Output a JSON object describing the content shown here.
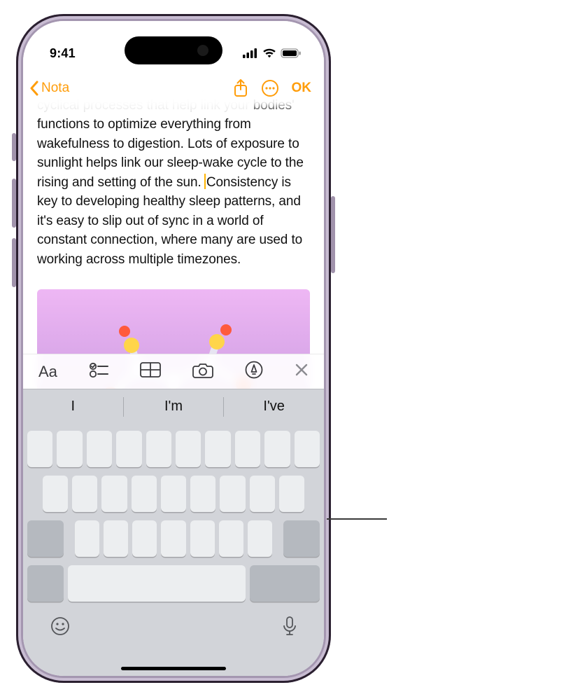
{
  "status": {
    "time": "9:41"
  },
  "nav": {
    "back_label": "Nota",
    "ok_label": "OK"
  },
  "note": {
    "faded_prefix": "sunlight has a positive effect on the sleep/wake cycle, primarily because it is important at our circadian rhythm – a series of cyclical processes that help link your ",
    "body_a": "bodies' functions to optimize everything from wakefulness to digestion. Lots of exposure to sunlight helps link our sleep-wake cycle to the rising and setting of the sun. ",
    "body_b": "Consistency is key to developing healthy sleep patterns, and it's easy to slip out of sync in a world of constant connection, where many are used to working across multiple timezones."
  },
  "suggestions": {
    "s1": "I",
    "s2": "I'm",
    "s3": "I've"
  },
  "toolbar": {
    "format": "Aa"
  }
}
